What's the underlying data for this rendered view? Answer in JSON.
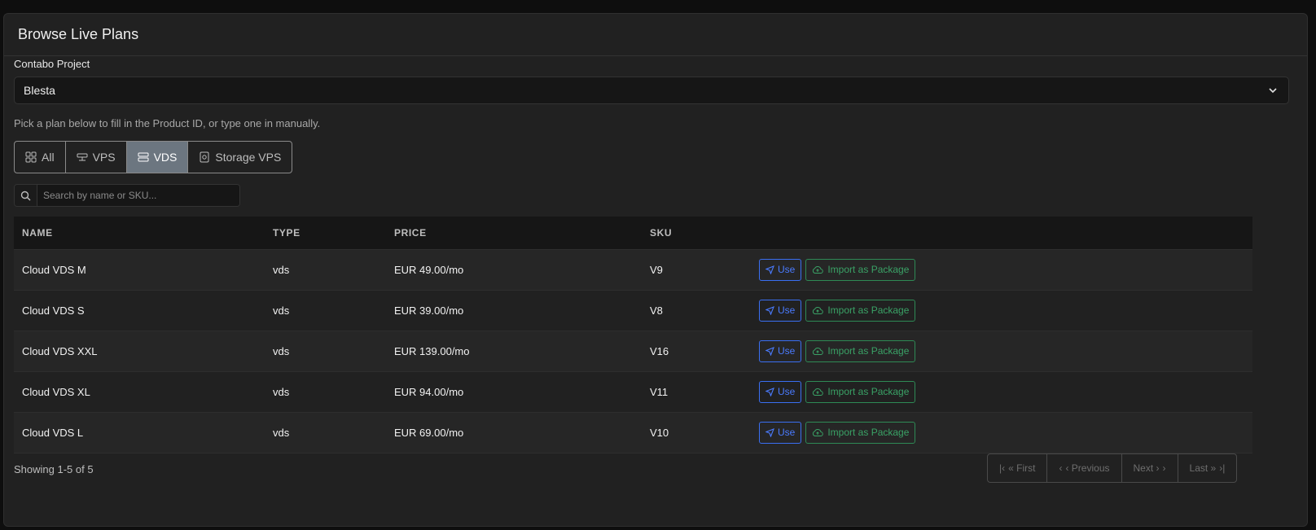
{
  "header": {
    "title": "Browse Live Plans"
  },
  "project": {
    "label": "Contabo Project",
    "selected": "Blesta"
  },
  "hint": "Pick a plan below to fill in the Product ID, or type one in manually.",
  "filters": [
    {
      "label": "All",
      "icon": "grid-icon",
      "active": false
    },
    {
      "label": "VPS",
      "icon": "server-icon",
      "active": false
    },
    {
      "label": "VDS",
      "icon": "server-stack-icon",
      "active": true
    },
    {
      "label": "Storage VPS",
      "icon": "storage-icon",
      "active": false
    }
  ],
  "search": {
    "placeholder": "Search by name or SKU..."
  },
  "table": {
    "columns": [
      "NAME",
      "TYPE",
      "PRICE",
      "SKU"
    ],
    "rows": [
      {
        "name": "Cloud VDS M",
        "type": "vds",
        "price": "EUR 49.00/mo",
        "sku": "V9"
      },
      {
        "name": "Cloud VDS S",
        "type": "vds",
        "price": "EUR 39.00/mo",
        "sku": "V8"
      },
      {
        "name": "Cloud VDS XXL",
        "type": "vds",
        "price": "EUR 139.00/mo",
        "sku": "V16"
      },
      {
        "name": "Cloud VDS XL",
        "type": "vds",
        "price": "EUR 94.00/mo",
        "sku": "V11"
      },
      {
        "name": "Cloud VDS L",
        "type": "vds",
        "price": "EUR 69.00/mo",
        "sku": "V10"
      }
    ],
    "use_label": "Use",
    "import_label": "Import as Package"
  },
  "footer": {
    "showing": "Showing 1-5 of 5",
    "pager": {
      "first": "« First",
      "previous": "‹ Previous",
      "next": "Next ›",
      "last": "Last »"
    }
  },
  "colors": {
    "accent_blue": "#3a6ff2",
    "accent_green": "#2e8a55",
    "active_filter": "#6c7680"
  }
}
